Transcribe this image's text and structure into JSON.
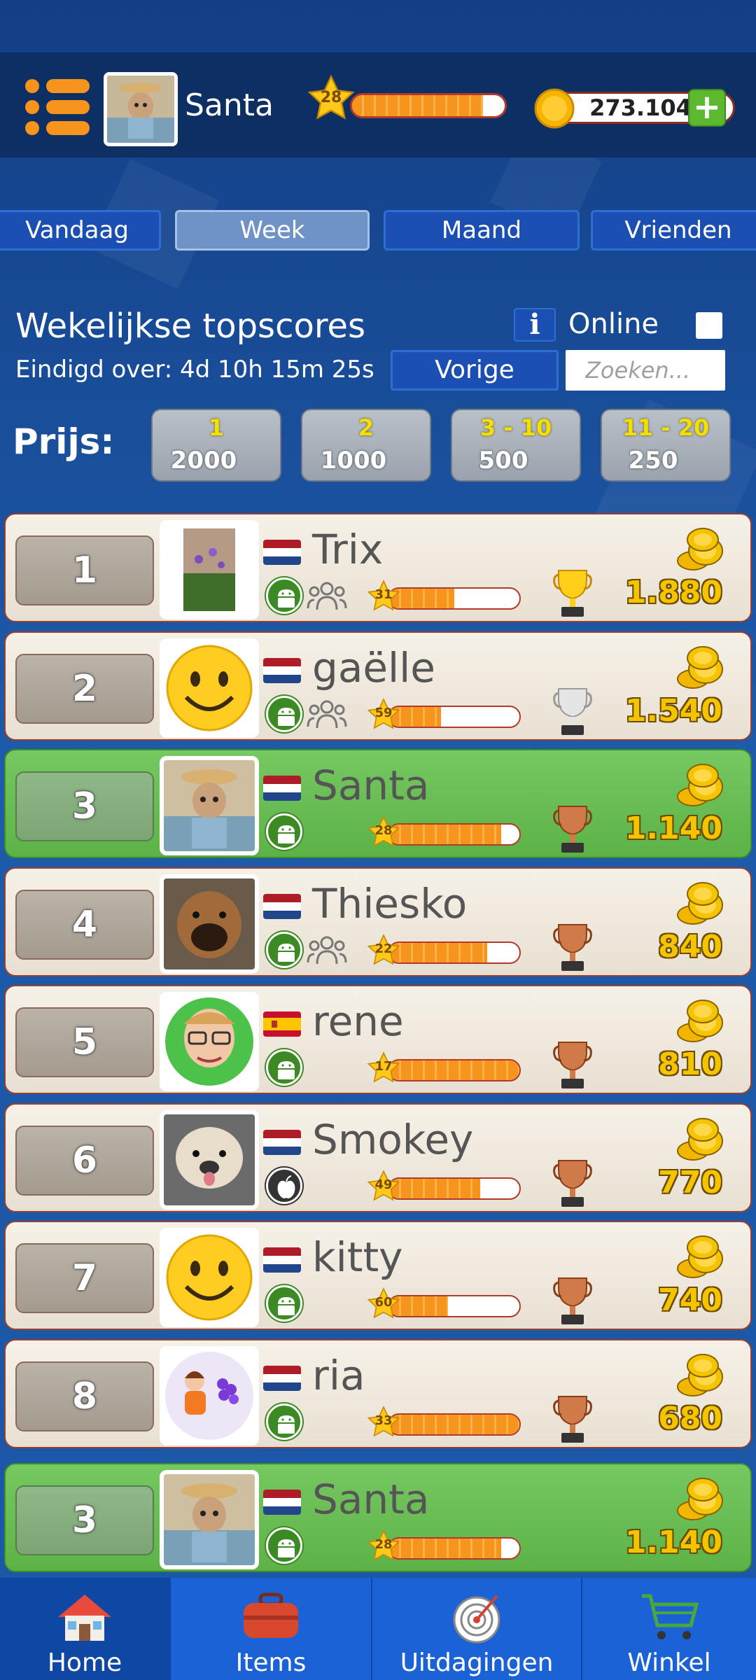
{
  "header": {
    "username": "Santa",
    "level": "28",
    "level_progress": 0.86,
    "coins": "273.104",
    "add_label": "+"
  },
  "tabs": [
    {
      "label": "Vandaag",
      "active": false
    },
    {
      "label": "Week",
      "active": true
    },
    {
      "label": "Maand",
      "active": false
    },
    {
      "label": "Vrienden",
      "active": false
    }
  ],
  "leaderboard": {
    "title": "Wekelijkse topscores",
    "ends": "Eindigd over: 4d 10h 15m 25s",
    "info_label": "i",
    "online_label": "Online",
    "online_checked": false,
    "previous_label": "Vorige",
    "search_placeholder": "Zoeken...",
    "prize_label": "Prijs:",
    "prizes": [
      {
        "rank": "1",
        "amount": "2000"
      },
      {
        "rank": "2",
        "amount": "1000"
      },
      {
        "rank": "3 - 10",
        "amount": "500"
      },
      {
        "rank": "11 - 20",
        "amount": "250"
      }
    ]
  },
  "rows": [
    {
      "rank": "1",
      "name": "Trix",
      "flag": "nl",
      "os": "android",
      "friend": true,
      "level": "31",
      "progress": 0.5,
      "trophy": "gold",
      "score": "1.880",
      "me": false,
      "avatar": "flowers"
    },
    {
      "rank": "2",
      "name": "gaëlle",
      "flag": "nl",
      "os": "android",
      "friend": true,
      "level": "59",
      "progress": 0.4,
      "trophy": "silver",
      "score": "1.540",
      "me": false,
      "avatar": "smiley"
    },
    {
      "rank": "3",
      "name": "Santa",
      "flag": "nl",
      "os": "android",
      "friend": false,
      "level": "28",
      "progress": 0.86,
      "trophy": "bronze",
      "score": "1.140",
      "me": true,
      "avatar": "dog-hat"
    },
    {
      "rank": "4",
      "name": "Thiesko",
      "flag": "nl",
      "os": "android",
      "friend": true,
      "level": "22",
      "progress": 0.75,
      "trophy": "bronze",
      "score": "840",
      "me": false,
      "avatar": "dog-boxer"
    },
    {
      "rank": "5",
      "name": "rene",
      "flag": "es",
      "os": "android",
      "friend": false,
      "level": "17",
      "progress": 1.0,
      "trophy": "bronze",
      "score": "810",
      "me": false,
      "avatar": "man-glasses"
    },
    {
      "rank": "6",
      "name": "Smokey",
      "flag": "nl",
      "os": "apple",
      "friend": false,
      "level": "49",
      "progress": 0.7,
      "trophy": "bronze",
      "score": "770",
      "me": false,
      "avatar": "dog-shih"
    },
    {
      "rank": "7",
      "name": "kitty",
      "flag": "nl",
      "os": "android",
      "friend": false,
      "level": "60",
      "progress": 0.45,
      "trophy": "bronze",
      "score": "740",
      "me": false,
      "avatar": "smiley"
    },
    {
      "rank": "8",
      "name": "ria",
      "flag": "nl",
      "os": "android",
      "friend": false,
      "level": "33",
      "progress": 1.0,
      "trophy": "bronze",
      "score": "680",
      "me": false,
      "avatar": "girl-hearts"
    }
  ],
  "my_row": {
    "rank": "3",
    "name": "Santa",
    "flag": "nl",
    "os": "android",
    "level": "28",
    "progress": 0.86,
    "score": "1.140",
    "avatar": "dog-hat"
  },
  "nav": [
    {
      "label": "Home",
      "icon": "house-icon",
      "active": true
    },
    {
      "label": "Items",
      "icon": "bag-icon",
      "active": false
    },
    {
      "label": "Uitdagingen",
      "icon": "target-icon",
      "active": false
    },
    {
      "label": "Winkel",
      "icon": "cart-icon",
      "active": false
    }
  ],
  "colors": {
    "accent_orange": "#f7941d",
    "me_green": "#5cb247",
    "coin_gold": "#f5c400",
    "tab_blue": "#1b4fb1"
  }
}
